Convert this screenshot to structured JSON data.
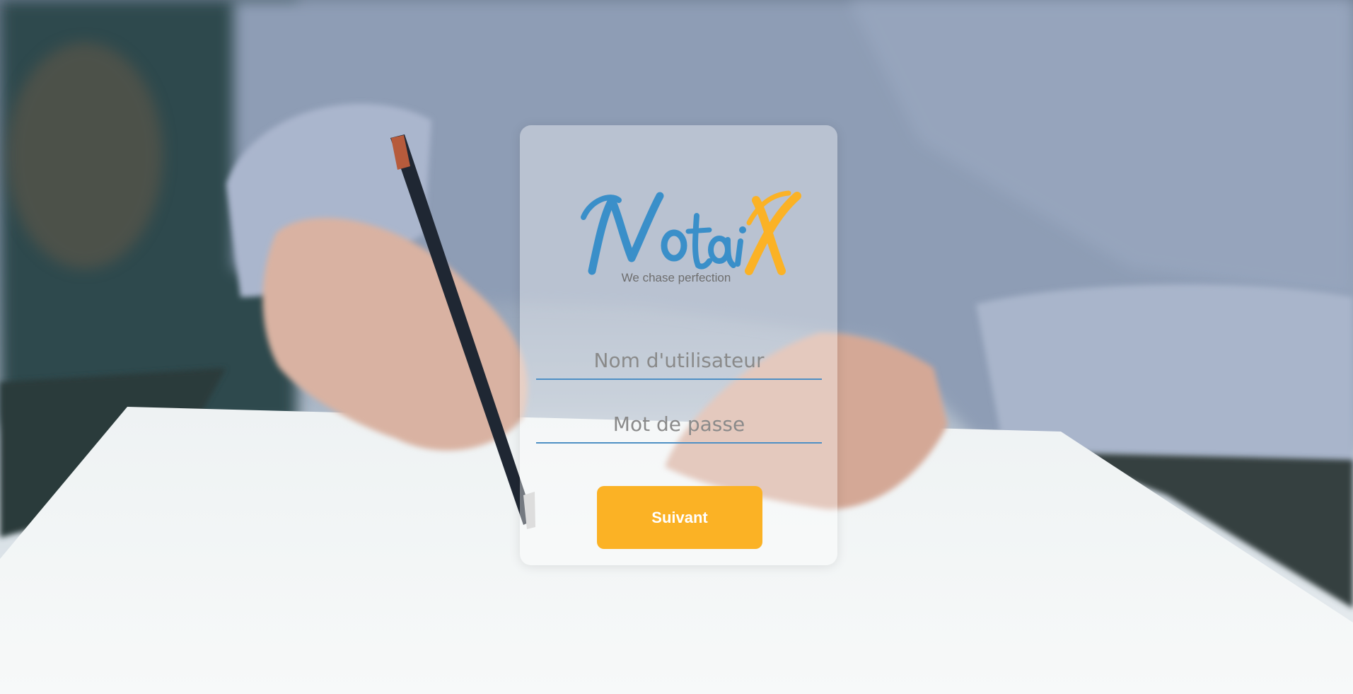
{
  "brand": {
    "logo_text": "NotaiX",
    "tagline": "We chase perfection"
  },
  "colors": {
    "primary_blue": "#3a8fc9",
    "accent_yellow": "#fbb225",
    "field_underline": "#4e8fc4",
    "button_text": "#ffffff"
  },
  "form": {
    "username_placeholder": "Nom d'utilisateur",
    "username_value": "",
    "password_placeholder": "Mot de passe",
    "password_value": "",
    "submit_label": "Suivant"
  }
}
